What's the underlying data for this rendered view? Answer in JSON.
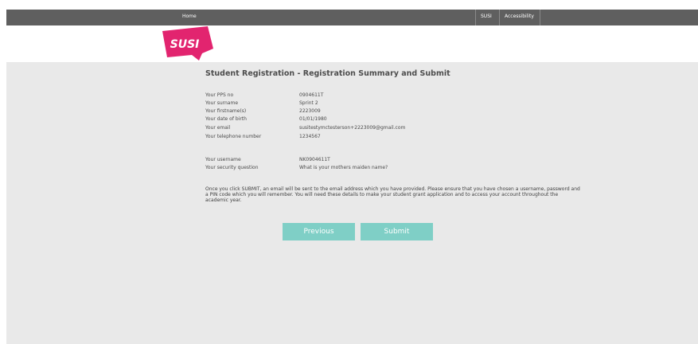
{
  "nav": {
    "home": "Home",
    "susi": "SUSI",
    "accessibility": "Accessibility"
  },
  "logo": {
    "text": "SUSI",
    "color": "#e2246f"
  },
  "page": {
    "title": "Student Registration - Registration Summary and Submit"
  },
  "summary": [
    {
      "label": "Your PPS no",
      "value": "0904611T"
    },
    {
      "label": "Your surname",
      "value": "Sprint 2"
    },
    {
      "label": "Your firstname(s)",
      "value": "2223009"
    },
    {
      "label": "Your date of birth",
      "value": "01/01/1980"
    },
    {
      "label": "Your email",
      "value": "susitestymctesterson+2223009@gmail.com"
    },
    {
      "label": "Your telephone number",
      "value": "1234567"
    }
  ],
  "account": [
    {
      "label": "Your username",
      "value": "NK0904611T"
    },
    {
      "label": "Your security question",
      "value": "What is your mothers maiden name?"
    }
  ],
  "notice": "Once you click SUBMIT, an email will be sent to the email address which you have provided. Please ensure that you have chosen a username, password and a PIN code which you will remember. You will need these details to make your student grant application and to access your account throughout the academic year.",
  "buttons": {
    "previous": "Previous",
    "submit": "Submit"
  },
  "colors": {
    "topbar": "#5f5f5f",
    "background": "#e9e9e9",
    "button": "#7fcfc6"
  }
}
